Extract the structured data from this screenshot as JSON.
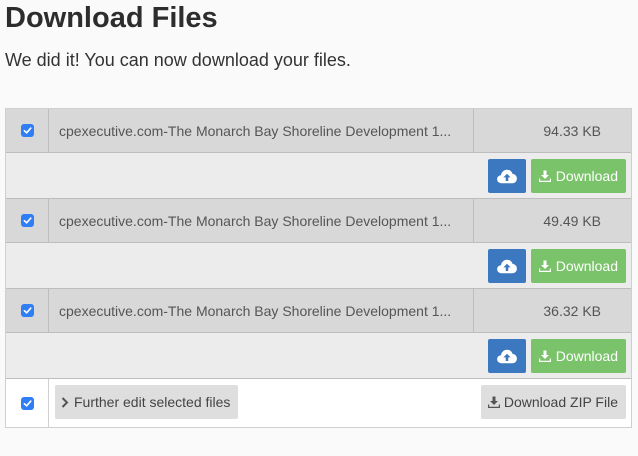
{
  "page": {
    "title": "Download Files",
    "subtitle": "We did it! You can now download your files."
  },
  "files": [
    {
      "name": "cpexecutive.com-The Monarch Bay Shoreline Development 1...",
      "size": "94.33 KB",
      "download_label": "Download",
      "checked": true
    },
    {
      "name": "cpexecutive.com-The Monarch Bay Shoreline Development 1...",
      "size": "49.49 KB",
      "download_label": "Download",
      "checked": true
    },
    {
      "name": "cpexecutive.com-The Monarch Bay Shoreline Development 1...",
      "size": "36.32 KB",
      "download_label": "Download",
      "checked": true
    }
  ],
  "footer": {
    "further_edit_label": "Further edit selected files",
    "zip_label": "Download ZIP File",
    "checked": true
  },
  "icons": {
    "checkbox": "checkbox-icon",
    "upload": "cloud-upload-icon",
    "download": "download-icon",
    "further": "chevron-right-icon",
    "zip": "download-icon"
  },
  "colors": {
    "checkbox": "#2f7ef6",
    "upload_button": "#3c78bf",
    "download_button": "#7ac36a",
    "gray_button": "#dedede",
    "file_row": "#d8d8d8",
    "action_row": "#ececec"
  }
}
